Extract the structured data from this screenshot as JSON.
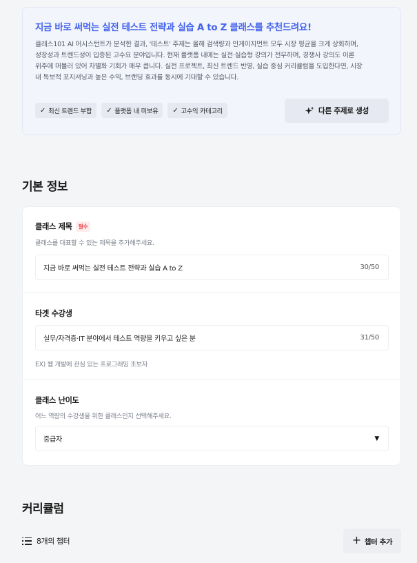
{
  "ai": {
    "title": "지금 바로 써먹는 실전 테스트 전략과 실습 A to Z 클래스를 추천드려요!",
    "desc_lines": [
      "클래스101 AI 어시스턴트가 분석한 결과, '테스트' 주제는 올해 검색량과 인게이지먼트 모두 시장 평균을 크게 상회하며,",
      "성장성과 트렌드성이 입증된 고수요 분야입니다. 현재 플랫폼 내에는 실전·실습형 강의가 전무하며, 경쟁사 강의도 이론",
      "위주에 머물러 있어 차별화 기회가 매우 큽니다. 실전 프로젝트, 최신 트렌드 반영, 실습 중심 커리큘럼을 도입한다면, 시장",
      "내 독보적 포지셔닝과 높은 수익, 브랜딩 효과를 동시에 기대할 수 있습니다."
    ],
    "tags": [
      "최신 트렌드 부합",
      "플랫폼 내 미보유",
      "고수익 카테고리"
    ],
    "check_glyph": "✓",
    "generate_label": "다른 주제로 생성",
    "generate_icon": "sparkle-icon"
  },
  "basic": {
    "section_title": "기본 정보",
    "class_title": {
      "label": "클래스 제목",
      "required_badge": "필수",
      "help": "클래스를 대표할 수 있는 제목을 추가해주세요.",
      "value": "지금 바로 써먹는 실전 테스트 전략과 실습 A to Z",
      "count": "30/50"
    },
    "target": {
      "label": "타겟 수강생",
      "value": "실무/자격증·IT 분야에서 테스트 역량을 키우고 싶은 분",
      "count": "31/50",
      "example": "EX) 웹 개발에 관심 있는 프로그래밍 초보자"
    },
    "difficulty": {
      "label": "클래스 난이도",
      "help": "어느 역량의 수강생을 위한 클래스인지 선택해주세요.",
      "selected": "중급자",
      "caret": "▼"
    }
  },
  "curriculum": {
    "section_title": "커리큘럼",
    "chapter_count": "8개의 챕터",
    "add_chapter_label": "챕터 추가",
    "add_glyph": "+"
  },
  "colors": {
    "accent": "#4263eb",
    "required": "#e5484d",
    "card_bg": "#f3f5fd",
    "page_bg": "#f4f5f7"
  }
}
